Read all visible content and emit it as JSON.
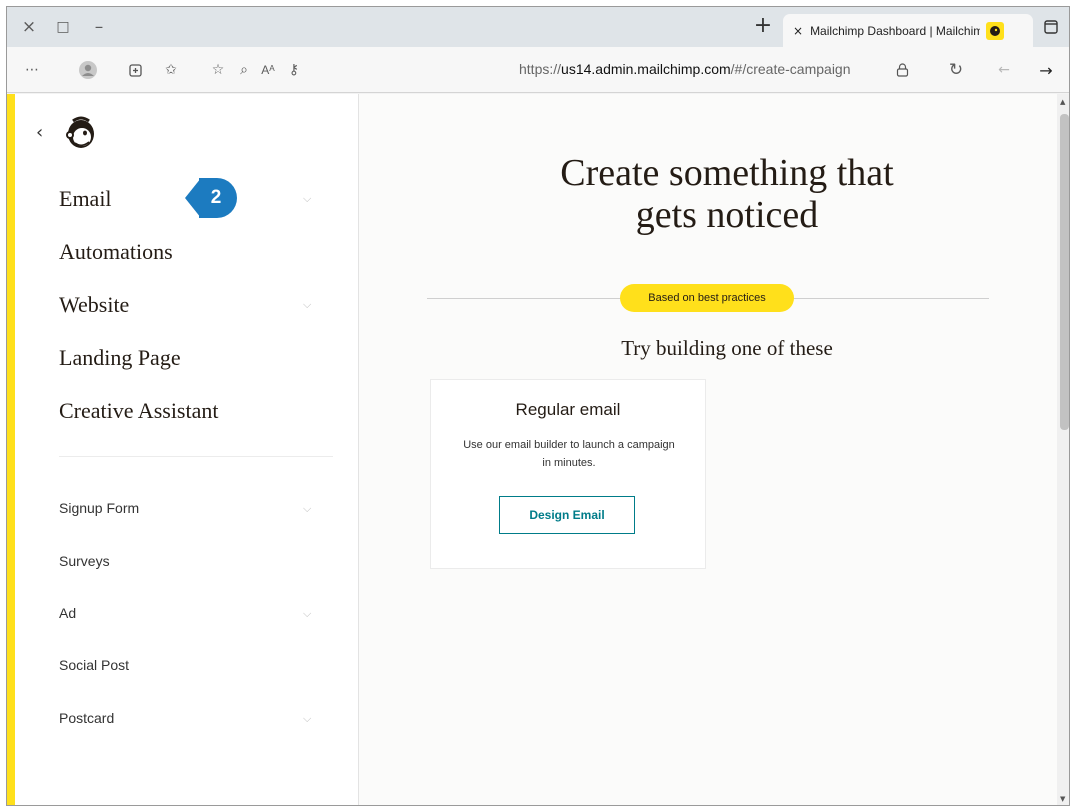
{
  "browser": {
    "window_controls": {
      "close": "×",
      "restore": "□",
      "minimize": "–"
    },
    "new_tab": "+",
    "tab": {
      "close": "×",
      "title": "Mailchimp Dashboard | Mailchimp"
    },
    "url_host": "us14.admin.mailchimp.com",
    "url_prefix": "https://",
    "url_path": "/#/create-campaign",
    "toolbar_icons": [
      "more-icon",
      "profile-icon",
      "collections-icon",
      "favorites-icon",
      "add-favorite-icon",
      "zoom-icon",
      "read-aloud-icon",
      "key-icon",
      "lock-icon",
      "refresh-icon",
      "back-icon",
      "forward-icon"
    ]
  },
  "sidebar": {
    "back_glyph": "‹",
    "primary_items": [
      {
        "label": "Email",
        "has_chevron": true
      },
      {
        "label": "Automations",
        "has_chevron": false
      },
      {
        "label": "Website",
        "has_chevron": true
      },
      {
        "label": "Landing Page",
        "has_chevron": false
      },
      {
        "label": "Creative Assistant",
        "has_chevron": false
      }
    ],
    "secondary_items": [
      {
        "label": "Signup Form",
        "has_chevron": true
      },
      {
        "label": "Surveys",
        "has_chevron": false
      },
      {
        "label": "Ad",
        "has_chevron": true
      },
      {
        "label": "Social Post",
        "has_chevron": false
      },
      {
        "label": "Postcard",
        "has_chevron": true
      }
    ]
  },
  "step_badge": "2",
  "main": {
    "heading_line1": "Create something that",
    "heading_line2": "gets noticed",
    "pill": "Based on best practices",
    "try_text": "Try building one of these",
    "card": {
      "title": "Regular email",
      "description": "Use our email builder to launch a campaign in minutes.",
      "button": "Design Email"
    }
  },
  "colors": {
    "brand_yellow": "#ffe01b",
    "teal": "#007c89",
    "badge_blue": "#1c7bc0"
  }
}
